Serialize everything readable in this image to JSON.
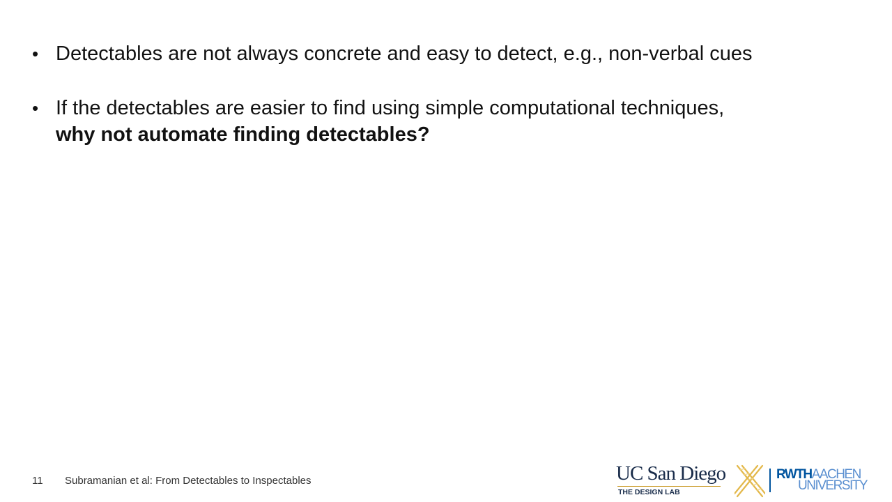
{
  "slide": {
    "bullets": [
      {
        "marker": "•",
        "text": "Detectables are not always concrete and easy to detect, e.g., non-verbal cues"
      },
      {
        "marker": "•",
        "text": "If the detectables are easier to find using simple computational techniques,",
        "bold_text": "why not automate finding detectables?"
      }
    ]
  },
  "footer": {
    "page_number": "11",
    "citation": "Subramanian et al: From Detectables to Inspectables"
  },
  "logos": {
    "ucsd": {
      "wordmark": "UC San Diego",
      "subtitle": "THE DESIGN LAB",
      "color": "#182b49",
      "accent_color": "#c69214"
    },
    "rwth": {
      "line1_a": "RWTH",
      "line1_b": "AACHEN",
      "line2": "UNIVERSITY",
      "color": "#00549f"
    }
  }
}
